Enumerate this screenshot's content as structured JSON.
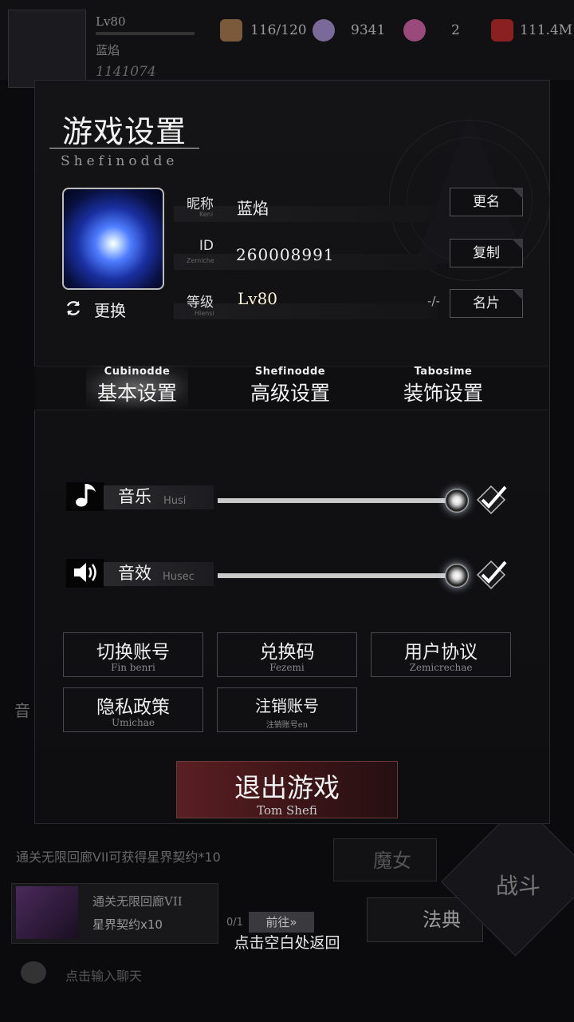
{
  "background": {
    "level": "Lv80",
    "name": "蓝焰",
    "power": "1141074",
    "resources": [
      "116/120",
      "9341",
      "2",
      "111.4M"
    ],
    "notice": "通关无限回廊VII可获得星界契约*10",
    "task": {
      "title": "通关无限回廊VII",
      "reward": "星界契约x10",
      "progress": "0/1",
      "goto": "前往»"
    },
    "chat_placeholder": "点击输入聊天",
    "witch": "魔女",
    "codex": "法典",
    "battle": "战斗",
    "left_label": "音"
  },
  "dialog": {
    "title": "游戏设置",
    "subtitle": "Shefinodde",
    "avatar": {
      "change_label": "更换"
    },
    "profile": {
      "nickname": {
        "label": "昵称",
        "sub": "Keni",
        "value": "蓝焰",
        "button": "更名"
      },
      "id": {
        "label": "ID",
        "sub": "Zemiche",
        "value": "260008991",
        "button": "复制"
      },
      "level": {
        "label": "等级",
        "sub": "Hlensi",
        "value": "Lv80",
        "extra": "-/-",
        "button": "名片"
      }
    },
    "tabs": [
      {
        "en": "Cubinodde",
        "cn": "基本设置",
        "active": true
      },
      {
        "en": "Shefinodde",
        "cn": "高级设置",
        "active": false
      },
      {
        "en": "Tabosime",
        "cn": "装饰设置",
        "active": false
      }
    ],
    "volume": {
      "music": {
        "cn": "音乐",
        "en": "Husi",
        "level": 1.0,
        "enabled": true
      },
      "sfx": {
        "cn": "音效",
        "en": "Husec",
        "level": 1.0,
        "enabled": true
      }
    },
    "menu_buttons": [
      {
        "cn": "切换账号",
        "en": "Fin benri"
      },
      {
        "cn": "兑换码",
        "en": "Fezemi"
      },
      {
        "cn": "用户协议",
        "en": "Zemicrechae"
      },
      {
        "cn": "隐私政策",
        "en": "Umichae"
      },
      {
        "cn": "注销账号",
        "en": "注销账号en"
      }
    ],
    "exit": {
      "cn": "退出游戏",
      "en": "Tom Shefi"
    },
    "return_hint": "点击空白处返回"
  }
}
